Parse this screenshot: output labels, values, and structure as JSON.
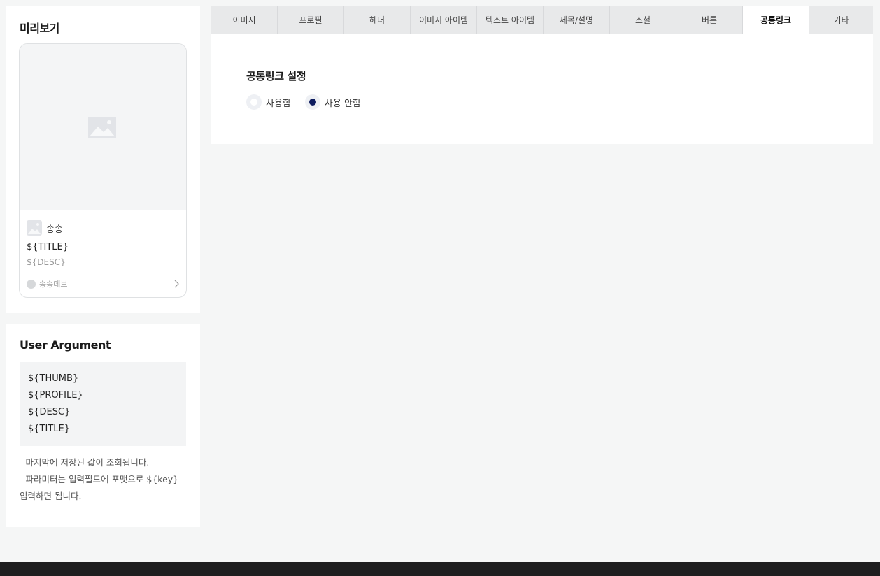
{
  "preview": {
    "title": "미리보기",
    "card": {
      "thumb_icon": "image-placeholder-icon",
      "profile_icon": "image-placeholder-icon",
      "profile_name": "송송",
      "title": "${TITLE}",
      "desc": "${DESC}",
      "footer_name": "송송데브",
      "footer_icon": "chevron-right-icon"
    }
  },
  "user_argument": {
    "title": "User Argument",
    "args": [
      "${THUMB}",
      "${PROFILE}",
      "${DESC}",
      "${TITLE}"
    ],
    "notes": [
      "- 마지막에 저장된 값이 조회됩니다.",
      "- 파라미터는 입력필드에 포맷으로 ${key}",
      "입력하면 됩니다."
    ]
  },
  "tabs": [
    {
      "label": "이미지",
      "active": false
    },
    {
      "label": "프로필",
      "active": false
    },
    {
      "label": "헤더",
      "active": false
    },
    {
      "label": "이미지 아이템",
      "active": false
    },
    {
      "label": "텍스트 아이템",
      "active": false
    },
    {
      "label": "제목/설명",
      "active": false
    },
    {
      "label": "소셜",
      "active": false
    },
    {
      "label": "버튼",
      "active": false
    },
    {
      "label": "공통링크",
      "active": true
    },
    {
      "label": "기타",
      "active": false
    }
  ],
  "common_link": {
    "section_title": "공통링크 설정",
    "options": [
      {
        "label": "사용함",
        "selected": false
      },
      {
        "label": "사용 안함",
        "selected": true
      }
    ]
  },
  "colors": {
    "accent": "#0d1b5e",
    "page_background": "#f5f6f6",
    "footer": "#1e1e1f"
  }
}
